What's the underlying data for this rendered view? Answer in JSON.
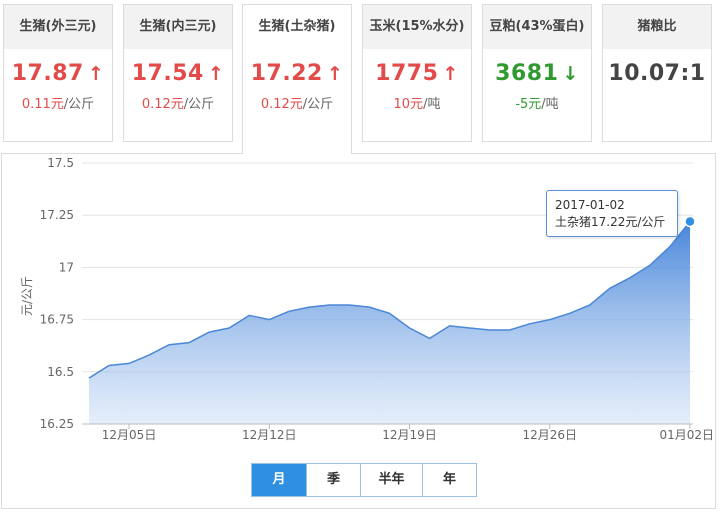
{
  "cards": [
    {
      "title": "生猪(外三元)",
      "price": "17.87",
      "arrow": "↑",
      "trend": "up",
      "change": "0.11元",
      "change_unit": "/公斤"
    },
    {
      "title": "生猪(内三元)",
      "price": "17.54",
      "arrow": "↑",
      "trend": "up",
      "change": "0.12元",
      "change_unit": "/公斤"
    },
    {
      "title": "生猪(土杂猪)",
      "price": "17.22",
      "arrow": "↑",
      "trend": "up",
      "change": "0.12元",
      "change_unit": "/公斤"
    },
    {
      "title": "玉米(15%水分)",
      "price": "1775",
      "arrow": "↑",
      "trend": "up",
      "change": "10元",
      "change_unit": "/吨"
    },
    {
      "title": "豆粕(43%蛋白)",
      "price": "3681",
      "arrow": "↓",
      "trend": "down",
      "change": "-5元",
      "change_unit": "/吨"
    },
    {
      "title": "猪粮比",
      "price": "10.07:1",
      "arrow": "",
      "trend": "none",
      "change": "",
      "change_unit": ""
    }
  ],
  "active_card": 2,
  "colors": {
    "up": "#e34b4b",
    "down": "#2f9a2f",
    "line": "#4a87d6",
    "accent": "#2f8fe0"
  },
  "tooltip": {
    "date": "2017-01-02",
    "text": "土杂猪17.22元/公斤"
  },
  "range_tabs": [
    "月",
    "季",
    "半年",
    "年"
  ],
  "active_range": 0,
  "chart_data": {
    "type": "area",
    "ylabel": "元/公斤",
    "ylim": [
      16.25,
      17.5
    ],
    "yticks": [
      16.25,
      16.5,
      16.75,
      17,
      17.25,
      17.5
    ],
    "ytick_labels": [
      "16.25",
      "16.5",
      "16.75",
      "17",
      "17.25",
      "17.5"
    ],
    "x_tick_labels": [
      "12月05日",
      "12月12日",
      "12月19日",
      "12月26日",
      "01月02日"
    ],
    "x": [
      "12-03",
      "12-04",
      "12-05",
      "12-06",
      "12-07",
      "12-08",
      "12-09",
      "12-10",
      "12-11",
      "12-12",
      "12-13",
      "12-14",
      "12-15",
      "12-16",
      "12-17",
      "12-18",
      "12-19",
      "12-20",
      "12-21",
      "12-22",
      "12-23",
      "12-24",
      "12-25",
      "12-26",
      "12-27",
      "12-28",
      "12-29",
      "12-30",
      "12-31",
      "01-01",
      "01-02"
    ],
    "x_tick_indices": [
      2,
      9,
      16,
      23,
      30
    ],
    "series": [
      {
        "values": [
          16.47,
          16.53,
          16.54,
          16.58,
          16.63,
          16.64,
          16.69,
          16.71,
          16.77,
          16.75,
          16.79,
          16.81,
          16.82,
          16.82,
          16.81,
          16.78,
          16.71,
          16.66,
          16.72,
          16.71,
          16.7,
          16.7,
          16.73,
          16.75,
          16.78,
          16.82,
          16.9,
          16.95,
          17.01,
          17.1,
          17.22
        ]
      }
    ],
    "legend": "none",
    "grid": true
  }
}
